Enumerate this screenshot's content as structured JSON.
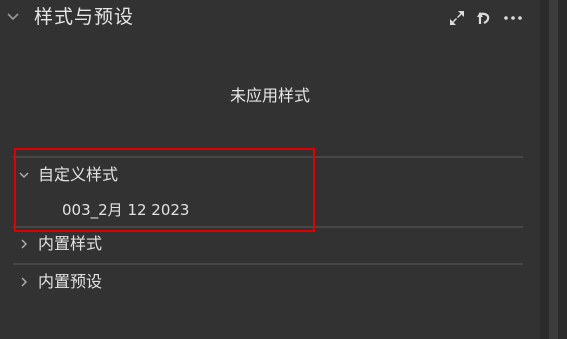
{
  "panel": {
    "title": "样式与预设",
    "empty_message": "未应用样式",
    "header_icons": [
      "expand-icon",
      "undo-icon",
      "more-icon"
    ]
  },
  "sections": [
    {
      "label": "自定义样式",
      "expanded": true,
      "items": [
        "003_2月 12 2023"
      ]
    },
    {
      "label": "内置样式",
      "expanded": false,
      "items": []
    },
    {
      "label": "内置预设",
      "expanded": false,
      "items": []
    }
  ],
  "colors": {
    "background": "#323232",
    "divider": "#474747",
    "highlight": "#e00000",
    "text": "#e2e2e2"
  }
}
